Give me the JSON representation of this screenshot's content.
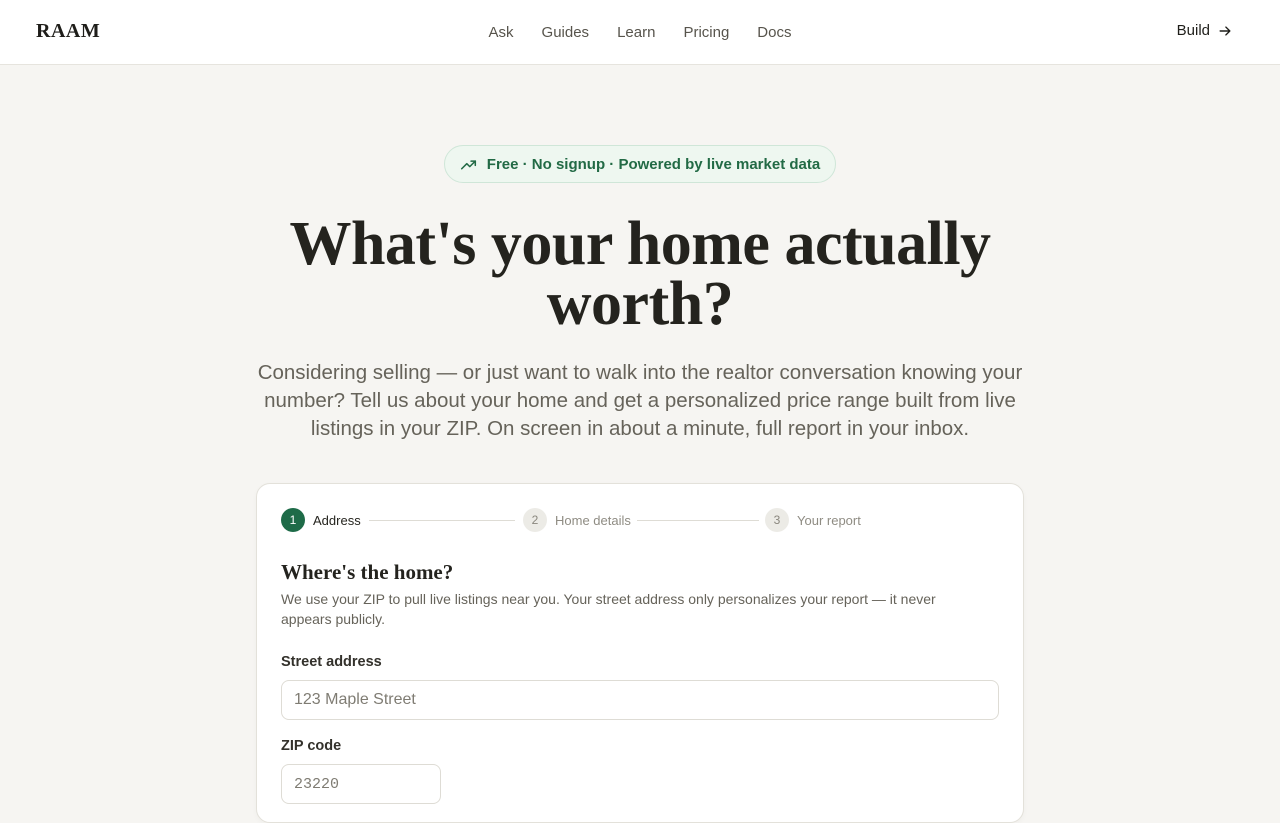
{
  "header": {
    "logo": "RAAM",
    "nav": [
      "Ask",
      "Guides",
      "Learn",
      "Pricing",
      "Docs"
    ],
    "build_label": "Build"
  },
  "hero": {
    "badge": "Free · No signup · Powered by live market data",
    "title": "What's your home actually worth?",
    "subtitle": "Considering selling — or just want to walk into the realtor conversation knowing your number? Tell us about your home and get a personalized price range built from live listings in your ZIP. On screen in about a minute, full report in your inbox."
  },
  "stepper": {
    "steps": [
      {
        "num": "1",
        "label": "Address"
      },
      {
        "num": "2",
        "label": "Home details"
      },
      {
        "num": "3",
        "label": "Your report"
      }
    ],
    "active_step": 1
  },
  "form": {
    "title": "Where's the home?",
    "description": "We use your ZIP to pull live listings near you. Your street address only personalizes your report — it never appears publicly.",
    "street_label": "Street address",
    "street_placeholder": "123 Maple Street",
    "zip_label": "ZIP code",
    "zip_placeholder": "23220"
  },
  "colors": {
    "accent": "#1e6b48",
    "badge_bg": "#eef7f0",
    "page_bg": "#f6f5f2"
  },
  "icons": {
    "badge_icon": "trending-up-icon",
    "build_icon": "arrow-right-icon"
  }
}
